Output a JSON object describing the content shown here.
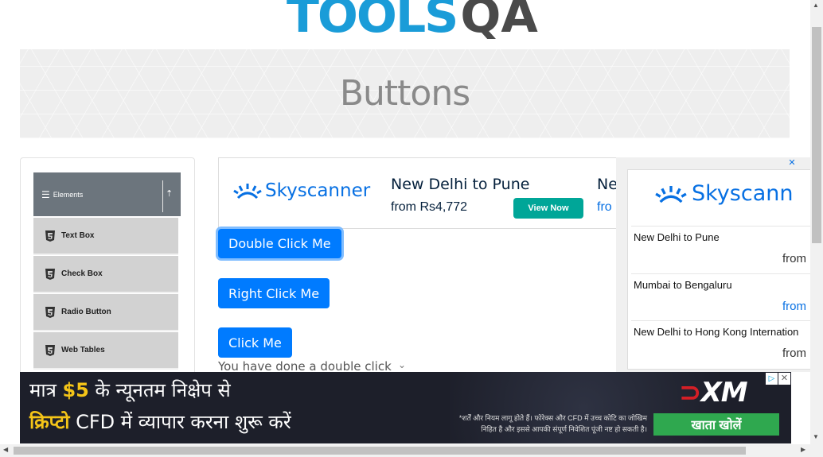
{
  "logo": {
    "tools": "TOOLS",
    "qa": "QA"
  },
  "banner": {
    "title": "Buttons"
  },
  "sidebar": {
    "group": "Elements",
    "items": [
      {
        "label": "Text Box"
      },
      {
        "label": "Check Box"
      },
      {
        "label": "Radio Button"
      },
      {
        "label": "Web Tables"
      }
    ]
  },
  "ad_skyscanner_main": {
    "brand": "Skyscanner",
    "card1": {
      "route": "New Delhi to Pune",
      "price": "from Rs4,772",
      "cta": "View Now"
    },
    "card2": {
      "route": "Ne",
      "price": "fro"
    }
  },
  "buttons": {
    "double_click": "Double Click Me",
    "right_click": "Right Click Me",
    "click": "Click Me"
  },
  "message": "You have done a double click",
  "ad_skyscanner_side": {
    "brand": "Skyscann",
    "rows": [
      {
        "route": "New Delhi to Pune",
        "from": "from"
      },
      {
        "route": "Mumbai to Bengaluru",
        "from": "from"
      },
      {
        "route": "New Delhi to Hong Kong Internation",
        "from": "from"
      }
    ]
  },
  "ad_xm": {
    "line1_a": "मात्र ",
    "line1_dollar": "$5",
    "line1_b": " के न्यूनतम निक्षेप से",
    "line2_crypto": "क्रिप्टो",
    "line2_b": " CFD में व्यापार करना शुरू करें",
    "disclaimer_1": "*शर्तें और नियम लागू होते हैं। फोरेक्स और CFD में उच्च कोटि का जोखिम",
    "disclaimer_2": "निहित है और इससे आपकी संपूर्ण निवेशित पूंजी नष्ट हो सकती है।",
    "brand": "XM",
    "cta": "खाता खोलें"
  },
  "colors": {
    "primary": "#007bff",
    "skyscanner": "#0770e3",
    "xm_green": "#2fa84f",
    "logo_blue": "#1a9cd8"
  }
}
